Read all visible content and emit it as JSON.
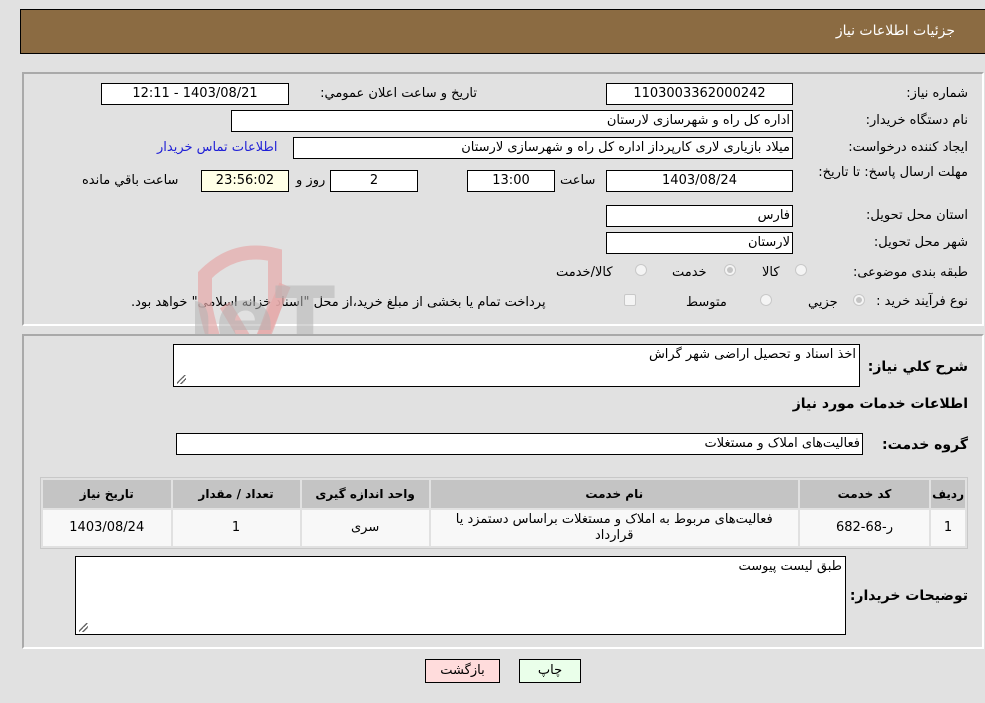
{
  "header": {
    "title": "جزئیات اطلاعات نیاز"
  },
  "form": {
    "need_number": {
      "label": "شماره نیاز:",
      "value": "1103003362000242"
    },
    "announce_datetime": {
      "label": "تاریخ و ساعت اعلان عمومي:",
      "value": "1403/08/21 - 12:11"
    },
    "buyer_org": {
      "label": "نام دستگاه خریدار:",
      "value": "اداره کل راه و شهرسازی لارستان"
    },
    "requester": {
      "label": "ایجاد کننده درخواست:",
      "value": "میلاد بازیاری لاری کارپرداز اداره کل راه و شهرسازی لارستان"
    },
    "buyer_contact_link": "اطلاعات تماس خریدار",
    "deadline": {
      "label": "مهلت ارسال پاسخ: تا تاریخ:",
      "date": "1403/08/24",
      "time_label": "ساعت",
      "time": "13:00",
      "days": "2",
      "days_label": "روز و",
      "remaining": "23:56:02",
      "remaining_label": "ساعت باقي مانده"
    },
    "province": {
      "label": "استان محل تحویل:",
      "value": "فارس"
    },
    "city": {
      "label": "شهر محل تحویل:",
      "value": "لارستان"
    },
    "category": {
      "label": "طبقه بندی موضوعی:",
      "options": [
        "کالا",
        "خدمت",
        "کالا/خدمت"
      ],
      "selected": "خدمت"
    },
    "purchase_process": {
      "label": "نوع فرآیند خرید :",
      "options": [
        "جزيي",
        "متوسط"
      ],
      "selected": "جزيي",
      "treasury_note": "پرداخت تمام یا بخشی از مبلغ خرید،از محل \"اسناد خزانه اسلامی\" خواهد بود."
    }
  },
  "details": {
    "general_desc_label": "شرح کلي نیاز:",
    "general_desc": "اخذ اسناد و تحصیل اراضی شهر گراش",
    "services_title": "اطلاعات خدمات مورد نیاز",
    "service_group_label": "گروه خدمت:",
    "service_group": "فعالیت‌های  املاک و مستغلات",
    "table": {
      "headers": [
        "ردیف",
        "کد خدمت",
        "نام خدمت",
        "واحد اندازه گیری",
        "تعداد / مقدار",
        "تاریخ نیاز"
      ],
      "rows": [
        [
          "1",
          "ر-68-682",
          "فعالیت‌های مربوط به املاک و مستغلات براساس دستمزد یا قرارداد",
          "سری",
          "1",
          "1403/08/24"
        ]
      ]
    },
    "buyer_notes_label": "توضیحات خریدار:",
    "buyer_notes": "طبق لیست پیوست"
  },
  "buttons": {
    "print": "چاپ",
    "back": "بازگشت"
  },
  "colors": {
    "header_bg": "#8b6b42",
    "print_bg": "#eaffea",
    "back_bg": "#ffdcdc",
    "link": "#1f1fd6"
  }
}
